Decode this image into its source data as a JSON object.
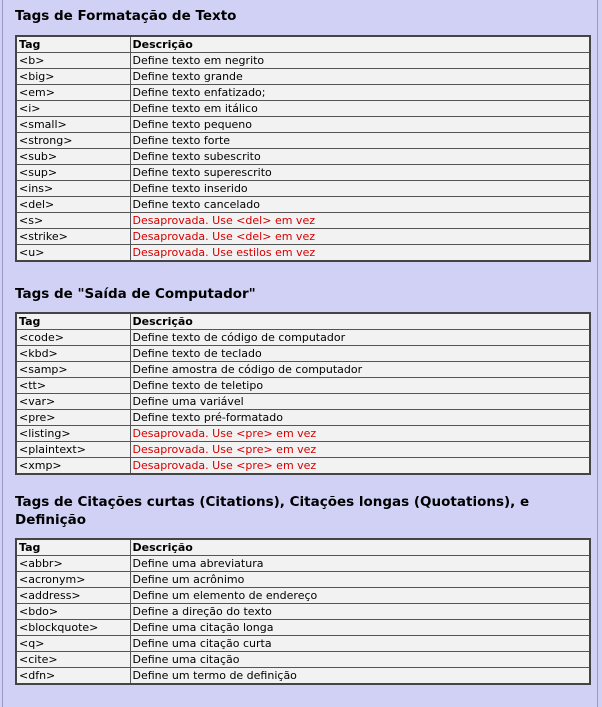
{
  "columns": {
    "tag": "Tag",
    "description": "Descrição"
  },
  "sections": [
    {
      "title": "Tags de Formatação de Texto",
      "rows": [
        {
          "tag": "<b>",
          "desc": "Define texto em negrito",
          "deprecated": false
        },
        {
          "tag": "<big>",
          "desc": "Define texto grande",
          "deprecated": false
        },
        {
          "tag": "<em>",
          "desc": "Define texto enfatizado;",
          "deprecated": false
        },
        {
          "tag": "<i>",
          "desc": "Define texto em itálico",
          "deprecated": false
        },
        {
          "tag": "<small>",
          "desc": "Define texto pequeno",
          "deprecated": false
        },
        {
          "tag": "<strong>",
          "desc": "Define texto forte",
          "deprecated": false
        },
        {
          "tag": "<sub>",
          "desc": "Define texto subescrito",
          "deprecated": false
        },
        {
          "tag": "<sup>",
          "desc": "Define texto superescrito",
          "deprecated": false
        },
        {
          "tag": "<ins>",
          "desc": "Define texto inserido",
          "deprecated": false
        },
        {
          "tag": "<del>",
          "desc": "Define texto cancelado",
          "deprecated": false
        },
        {
          "tag": "<s>",
          "desc": "Desaprovada. Use <del> em vez",
          "deprecated": true
        },
        {
          "tag": "<strike>",
          "desc": "Desaprovada. Use <del> em vez",
          "deprecated": true
        },
        {
          "tag": "<u>",
          "desc": "Desaprovada. Use estilos em vez",
          "deprecated": true
        }
      ]
    },
    {
      "title": "Tags de \"Saída de Computador\"",
      "rows": [
        {
          "tag": "<code>",
          "desc": "Define texto de código de computador",
          "deprecated": false
        },
        {
          "tag": "<kbd>",
          "desc": "Define texto de teclado",
          "deprecated": false
        },
        {
          "tag": "<samp>",
          "desc": "Define amostra de código de computador",
          "deprecated": false
        },
        {
          "tag": "<tt>",
          "desc": "Define texto de teletipo",
          "deprecated": false
        },
        {
          "tag": "<var>",
          "desc": "Define uma variável",
          "deprecated": false
        },
        {
          "tag": "<pre>",
          "desc": "Define texto pré-formatado",
          "deprecated": false
        },
        {
          "tag": "<listing>",
          "desc": "Desaprovada. Use <pre> em vez",
          "deprecated": true
        },
        {
          "tag": "<plaintext>",
          "desc": "Desaprovada. Use <pre> em vez",
          "deprecated": true
        },
        {
          "tag": "<xmp>",
          "desc": "Desaprovada. Use <pre> em vez",
          "deprecated": true
        }
      ]
    },
    {
      "title": "Tags de Citações curtas (Citations), Citações longas (Quotations), e Definição",
      "rows": [
        {
          "tag": "<abbr>",
          "desc": "Define uma abreviatura",
          "deprecated": false
        },
        {
          "tag": "<acronym>",
          "desc": "Define um acrônimo",
          "deprecated": false
        },
        {
          "tag": "<address>",
          "desc": "Define um elemento de endereço",
          "deprecated": false
        },
        {
          "tag": "<bdo>",
          "desc": "Define a direção do texto",
          "deprecated": false
        },
        {
          "tag": "<blockquote>",
          "desc": "Define uma citação longa",
          "deprecated": false
        },
        {
          "tag": "<q>",
          "desc": "Define uma citação curta",
          "deprecated": false
        },
        {
          "tag": "<cite>",
          "desc": "Define uma citação",
          "deprecated": false
        },
        {
          "tag": "<dfn>",
          "desc": "Define um termo de definição",
          "deprecated": false
        }
      ]
    }
  ],
  "colors": {
    "background": "#d1d1f6",
    "table_bg": "#f2f2f2",
    "deprecated_text": "#d40000"
  }
}
